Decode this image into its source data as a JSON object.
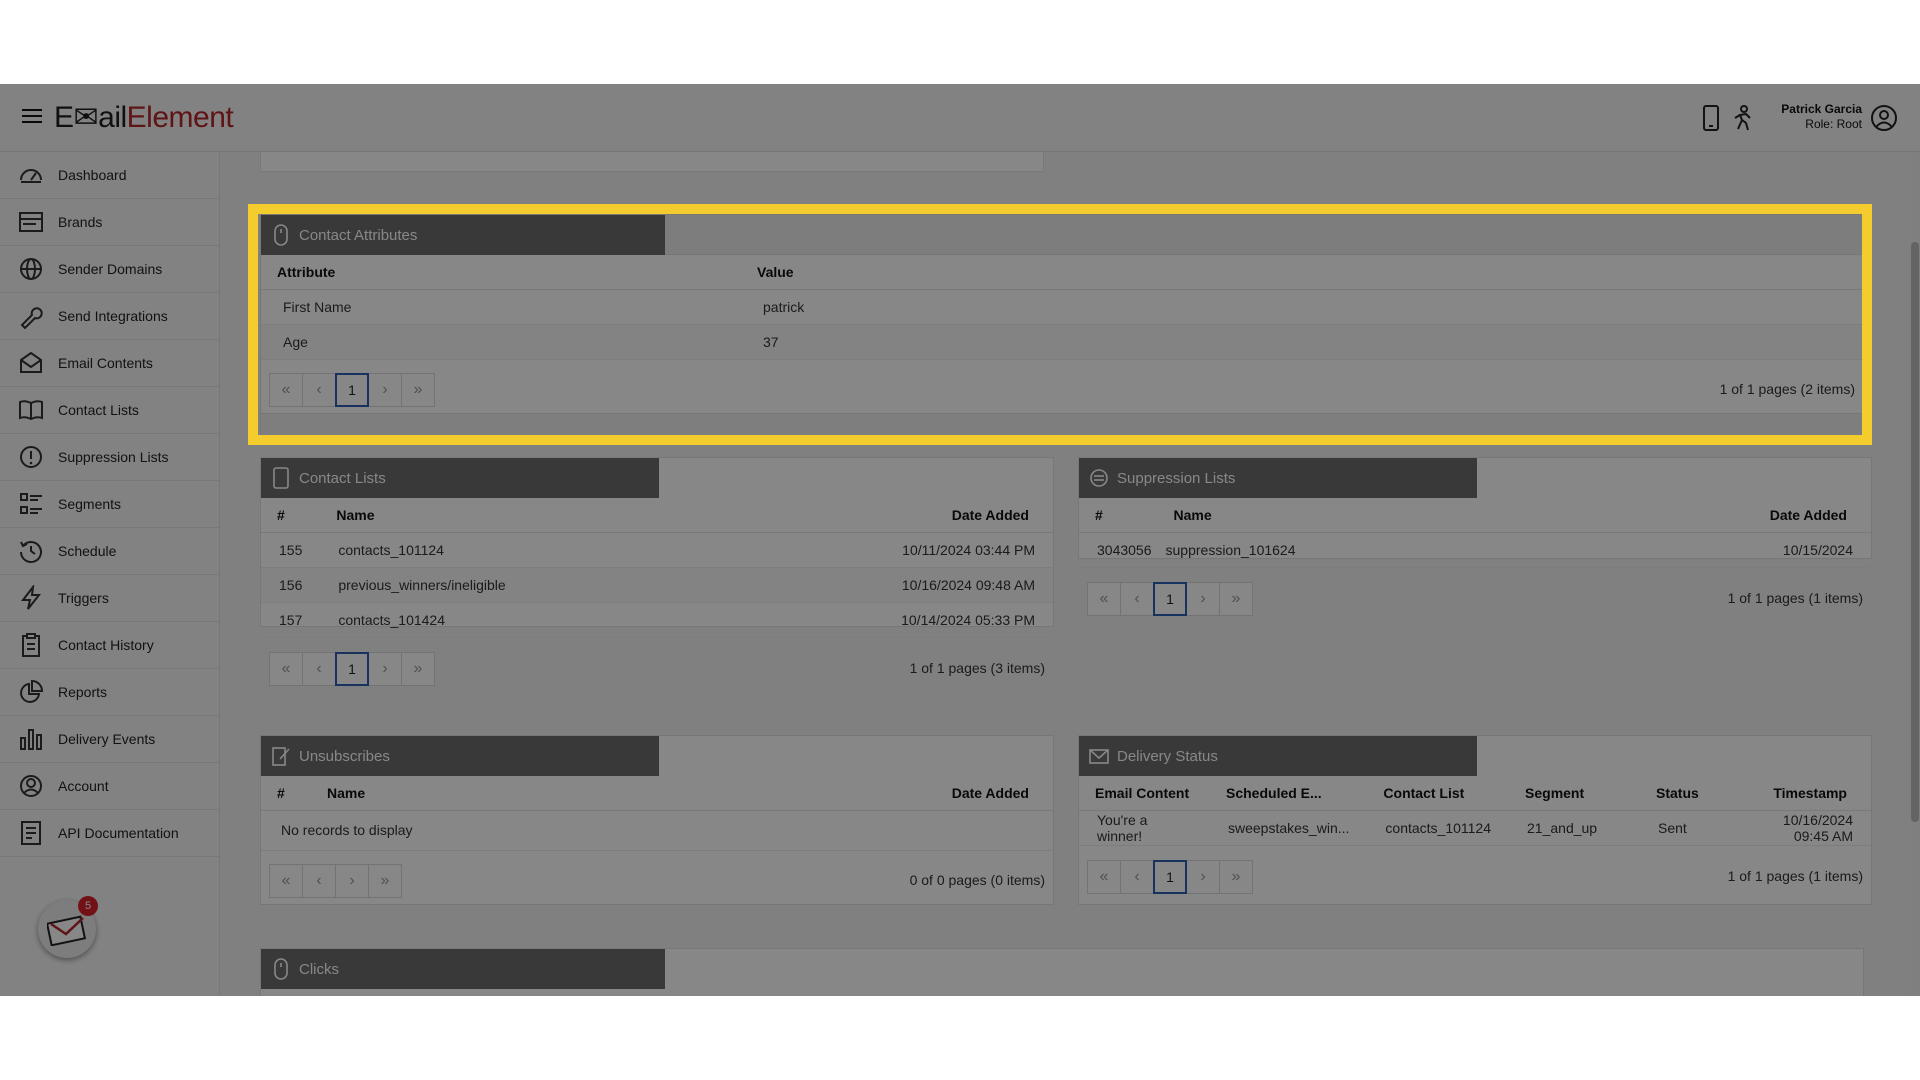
{
  "app": {
    "logo_part1": "E✉ail",
    "logo_part2": "Element"
  },
  "header": {
    "user_name": "Patrick Garcia",
    "user_role": "Role: Root"
  },
  "sidebar": {
    "items": [
      {
        "label": "Dashboard",
        "icon": "dashboard-icon"
      },
      {
        "label": "Brands",
        "icon": "brands-icon"
      },
      {
        "label": "Sender Domains",
        "icon": "globe-icon"
      },
      {
        "label": "Send Integrations",
        "icon": "wrench-icon"
      },
      {
        "label": "Email Contents",
        "icon": "envelope-icon"
      },
      {
        "label": "Contact Lists",
        "icon": "book-icon"
      },
      {
        "label": "Suppression Lists",
        "icon": "alert-icon"
      },
      {
        "label": "Segments",
        "icon": "segments-icon"
      },
      {
        "label": "Schedule",
        "icon": "clock-icon"
      },
      {
        "label": "Triggers",
        "icon": "bolt-icon"
      },
      {
        "label": "Contact History",
        "icon": "clipboard-icon"
      },
      {
        "label": "Reports",
        "icon": "pie-icon"
      },
      {
        "label": "Delivery Events",
        "icon": "bar-chart-icon"
      },
      {
        "label": "Account",
        "icon": "user-icon"
      },
      {
        "label": "API Documentation",
        "icon": "document-icon"
      }
    ],
    "notification_count": "5"
  },
  "pager": {
    "first": "«",
    "prev": "‹",
    "page": "1",
    "next": "›",
    "last": "»"
  },
  "contact_attributes": {
    "title": "Contact Attributes",
    "columns": [
      "Attribute",
      "Value"
    ],
    "rows": [
      {
        "attribute": "First Name",
        "value": "patrick"
      },
      {
        "attribute": "Age",
        "value": "37"
      }
    ],
    "page_info": "1 of 1 pages (2 items)"
  },
  "contact_lists": {
    "title": "Contact Lists",
    "columns": [
      "#",
      "Name",
      "Date Added"
    ],
    "rows": [
      {
        "id": "155",
        "name": "contacts_101124",
        "date": "10/11/2024 03:44 PM"
      },
      {
        "id": "156",
        "name": "previous_winners/ineligible",
        "date": "10/16/2024 09:48 AM"
      },
      {
        "id": "157",
        "name": "contacts_101424",
        "date": "10/14/2024 05:33 PM"
      }
    ],
    "page_info": "1 of 1 pages (3 items)"
  },
  "suppression_lists": {
    "title": "Suppression Lists",
    "columns": [
      "#",
      "Name",
      "Date Added"
    ],
    "rows": [
      {
        "id": "3043056",
        "name": "suppression_101624",
        "date": "10/15/2024"
      }
    ],
    "page_info": "1 of 1 pages (1 items)"
  },
  "unsubscribes": {
    "title": "Unsubscribes",
    "columns": [
      "#",
      "Name",
      "Date Added"
    ],
    "empty": "No records to display",
    "page_info": "0 of 0 pages (0 items)"
  },
  "delivery_status": {
    "title": "Delivery Status",
    "columns": [
      "Email Content",
      "Scheduled E...",
      "Contact List",
      "Segment",
      "Status",
      "Timestamp"
    ],
    "rows": [
      {
        "content": "You're a winner!",
        "scheduled": "sweepstakes_win...",
        "list": "contacts_101124",
        "segment": "21_and_up",
        "status": "Sent",
        "timestamp": "10/16/2024 09:45 AM"
      }
    ],
    "page_info": "1 of 1 pages (1 items)"
  },
  "clicks": {
    "title": "Clicks"
  },
  "colors": {
    "highlight": "#f4cc2e",
    "panel_title": "#6c6c6c",
    "brand_red": "#b3262a",
    "current_page_border": "#2f5fb3",
    "badge": "#d8232a"
  }
}
